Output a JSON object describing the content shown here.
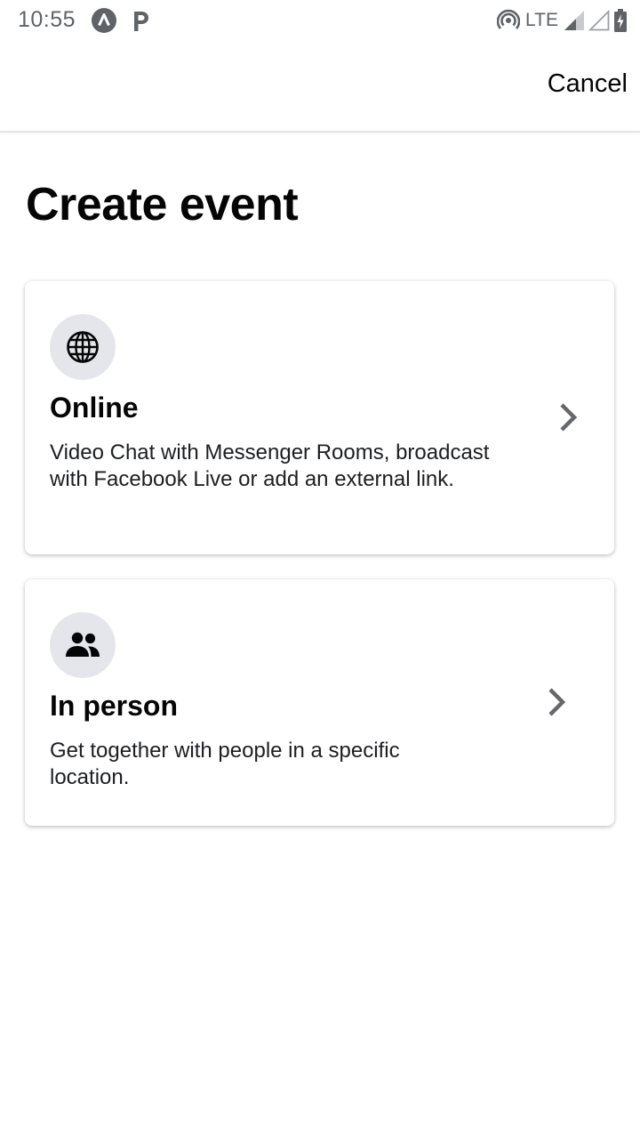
{
  "status_bar": {
    "time": "10:55",
    "network": "LTE",
    "icons": [
      "notification-a-icon",
      "notification-p-icon",
      "hotspot-icon",
      "signal-icon",
      "signal-empty-icon",
      "battery-charging-icon"
    ]
  },
  "header": {
    "cancel_label": "Cancel"
  },
  "page": {
    "title": "Create event"
  },
  "options": [
    {
      "icon": "globe-icon",
      "title": "Online",
      "description": "Video Chat with Messenger Rooms, broadcast with Facebook Live or add an external link."
    },
    {
      "icon": "people-icon",
      "title": "In person",
      "description": "Get together with people in a specific location."
    }
  ],
  "colors": {
    "icon_circle_bg": "#e4e6eb",
    "text_primary": "#050505",
    "chevron": "#65676b",
    "status_text": "#5f6368"
  }
}
